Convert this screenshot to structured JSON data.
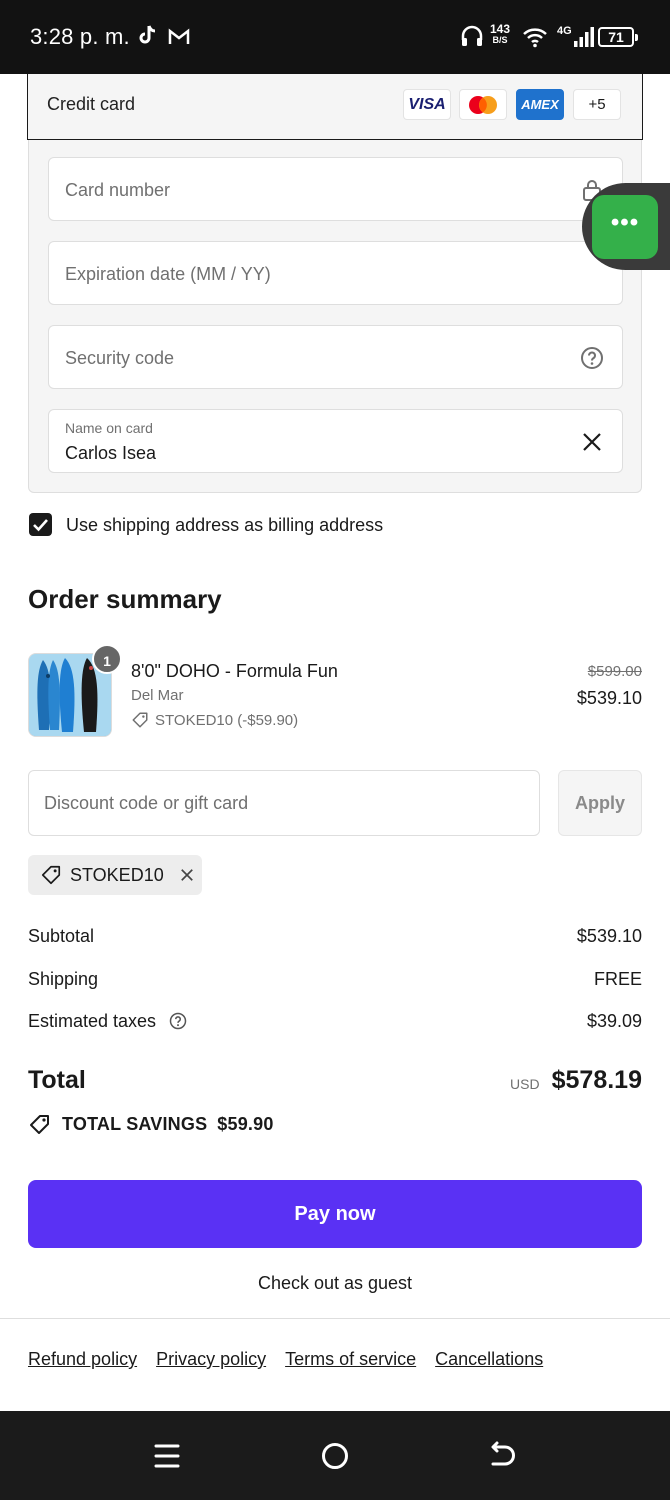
{
  "status_bar": {
    "time": "3:28 p. m.",
    "speed_value": "143",
    "speed_unit": "B/S",
    "network": "4G",
    "battery": "71"
  },
  "payment": {
    "title": "Credit card",
    "brands": [
      "VISA",
      "Mastercard",
      "AMEX"
    ],
    "brands_more": "+5",
    "card_number_placeholder": "Card number",
    "expiration_placeholder": "Expiration date (MM / YY)",
    "security_placeholder": "Security code",
    "name_label": "Name on card",
    "name_value": "Carlos Isea",
    "billing_checkbox_label": "Use shipping address as billing address"
  },
  "order": {
    "title": "Order summary",
    "item": {
      "quantity": "1",
      "name": "8'0\" DOHO - Formula Fun",
      "variant": "Del Mar",
      "discount": "STOKED10 (-$59.90)",
      "price_original": "$599.00",
      "price": "$539.10"
    },
    "discount_placeholder": "Discount code or gift card",
    "apply_label": "Apply",
    "applied_code": "STOKED10",
    "subtotal_label": "Subtotal",
    "subtotal_value": "$539.10",
    "shipping_label": "Shipping",
    "shipping_value": "FREE",
    "taxes_label": "Estimated taxes",
    "taxes_value": "$39.09",
    "total_label": "Total",
    "total_currency": "USD",
    "total_value": "$578.19",
    "savings_label": "TOTAL SAVINGS",
    "savings_value": "$59.90"
  },
  "actions": {
    "pay_label": "Pay now",
    "guest_label": "Check out as guest"
  },
  "footer": {
    "links": [
      "Refund policy",
      "Privacy policy",
      "Terms of service",
      "Cancellations"
    ]
  },
  "colors": {
    "pay_button": "#5a31f4",
    "chat_bubble": "#34b04a",
    "amex": "#1f72cd"
  }
}
